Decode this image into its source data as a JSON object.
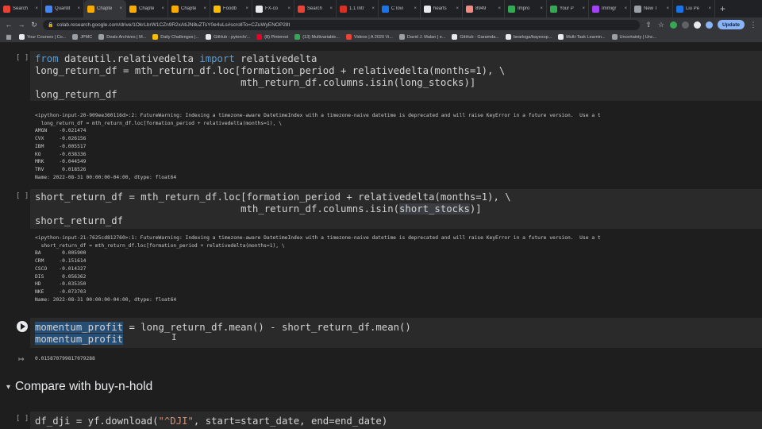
{
  "browser": {
    "tabs": [
      {
        "label": "Search",
        "color": "#ea4335"
      },
      {
        "label": "Quantit",
        "color": "#4285f4"
      },
      {
        "label": "Chapte",
        "color": "#f9ab00",
        "active": true
      },
      {
        "label": "Chapte",
        "color": "#f9ab00"
      },
      {
        "label": "Chapte",
        "color": "#f9ab00"
      },
      {
        "label": "Foodb",
        "color": "#fbbc04"
      },
      {
        "label": "FX-co",
        "color": "#e8eaed"
      },
      {
        "label": "Search",
        "color": "#ea4335"
      },
      {
        "label": "1.1 Intr",
        "color": "#d93025"
      },
      {
        "label": "C lovi",
        "color": "#1a73e8"
      },
      {
        "label": "hearts",
        "color": "#e8eaed"
      },
      {
        "label": "8949",
        "color": "#f28b82"
      },
      {
        "label": "Impro",
        "color": "#34a853"
      },
      {
        "label": "Your P",
        "color": "#34a853"
      },
      {
        "label": "Immigr",
        "color": "#a142f4"
      },
      {
        "label": "New T",
        "color": "#9aa0a6"
      },
      {
        "label": "Liu Pe",
        "color": "#1a73e8"
      }
    ],
    "new_tab": "+",
    "url": "colab.research.google.com/drive/1OkrLbrW1CZn9R2xAtiJN8uZTsY0e4uLs#scrollTo=CZuWyENOP28t",
    "update_label": "Update",
    "bookmarks": [
      {
        "label": "Your Courses | Co...",
        "color": "#e8eaed"
      },
      {
        "label": "JPMC",
        "color": "#9aa0a6"
      },
      {
        "label": "Deals Archives | M...",
        "color": "#9aa0a6"
      },
      {
        "label": "Daily Challenges |...",
        "color": "#fbbc04"
      },
      {
        "label": "GitHub - pytorch/...",
        "color": "#e8eaed"
      },
      {
        "label": "(8) Pinterest",
        "color": "#e60023"
      },
      {
        "label": "(13) Multivariable...",
        "color": "#34a853"
      },
      {
        "label": "Videos | A 2020 Vi...",
        "color": "#ea4335"
      },
      {
        "label": "David J. Malan | e...",
        "color": "#9aa0a6"
      },
      {
        "label": "GitHub - Garamda...",
        "color": "#e8eaed"
      },
      {
        "label": "bearloga/bayesop...",
        "color": "#e8eaed"
      },
      {
        "label": "Multi-Task Learnin...",
        "color": "#e8eaed"
      },
      {
        "label": "Uncertainty | Unc...",
        "color": "#9aa0a6"
      }
    ]
  },
  "cells": {
    "c1": {
      "run_label": "[ ]",
      "lines": {
        "l1a": "from",
        "l1b": " dateutil.relativedelta ",
        "l1c": "import",
        "l1d": " relativedelta",
        "l2": "long_return_df = mth_return_df.loc[formation_period + relativedelta(months=1), \\",
        "l3": "                                   mth_return_df.columns.isin(long_stocks)]",
        "l4": "long_return_df"
      },
      "output": "<ipython-input-20-909ee360116d>:2: FutureWarning: Indexing a timezone-aware DatetimeIndex with a timezone-naive datetime is deprecated and will raise KeyError in a future version.  Use a t\n  long_return_df = mth_return_df.loc[formation_period + relativedelta(months=1), \\\nAMGN    -0.021474\nCVX     -0.026156\nIBM     -0.005517\nKO      -0.038336\nMRK     -0.044549\nTRV      0.018526\nName: 2022-08-31 00:00:00-04:00, dtype: float64"
    },
    "c2": {
      "run_label": "[ ]",
      "lines": {
        "l1": "short_return_df = mth_return_df.loc[formation_period + relativedelta(months=1), \\",
        "l2a": "                                   mth_return_df.columns.isin(",
        "l2b": "short_stocks",
        "l2c": ")]",
        "l3": "short_return_df"
      },
      "output": "<ipython-input-21-7625cd812760>:1: FutureWarning: Indexing a timezone-aware DatetimeIndex with a timezone-naive datetime is deprecated and will raise KeyError in a future version.  Use a t\n  short_return_df = mth_return_df.loc[formation_period + relativedelta(months=1), \\\nBA       0.005900\nCRM     -0.151614\nCSCO    -0.014327\nDIS      0.056362\nHD      -0.035350\nNKE     -0.073703\nName: 2022-08-31 00:00:00-04:00, dtype: float64"
    },
    "c3": {
      "lines": {
        "l1a": "momentum_profit",
        "l1b": " = long_return_df.mean() - short_return_df.mean()",
        "l2": "momentum_profit"
      },
      "output": "0.015870799817079288"
    },
    "section": {
      "title": "Compare with buy-n-hold"
    },
    "c4": {
      "run_label": "[ ]",
      "lines": {
        "l1a": "df_dji = yf.download(",
        "l1b": "\"^DJI\"",
        "l1c": ", start=start_date, end=end_date)"
      }
    }
  }
}
